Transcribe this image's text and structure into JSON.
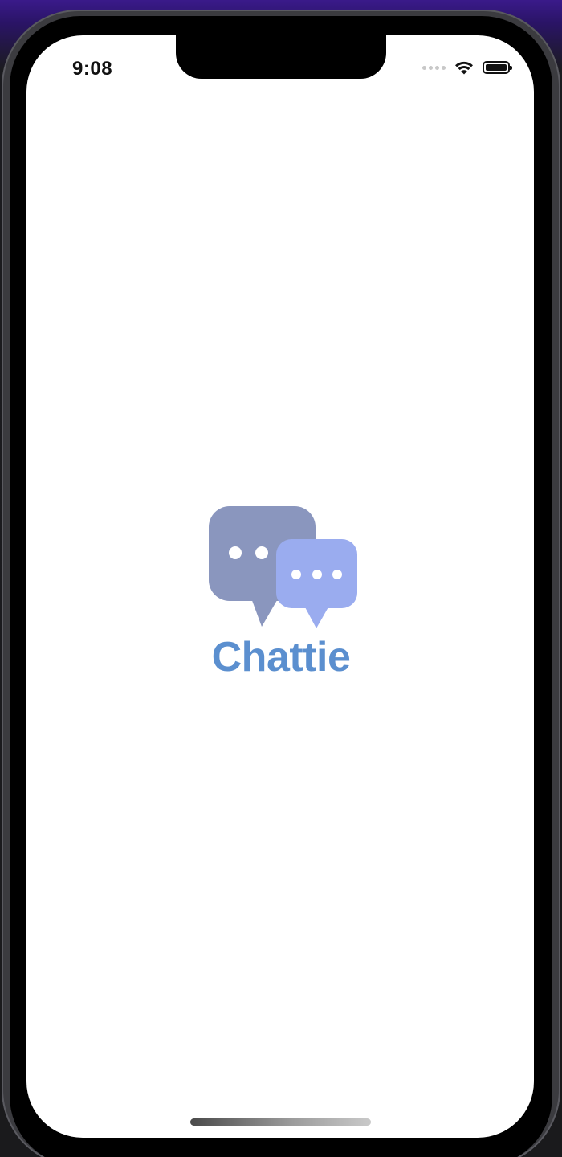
{
  "status_bar": {
    "time": "9:08",
    "signal_icon": "signal-dots-icon",
    "wifi_icon": "wifi-icon",
    "battery_icon": "battery-icon"
  },
  "splash": {
    "logo_icon": "chat-bubbles-icon",
    "app_name": "Chattie"
  },
  "colors": {
    "bubble_large": "#8a96be",
    "bubble_small": "#9aacef",
    "wordmark": "#5b8fcf",
    "screen_background": "#ffffff"
  }
}
